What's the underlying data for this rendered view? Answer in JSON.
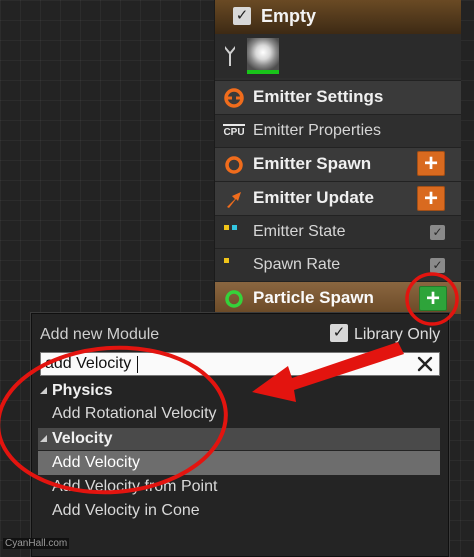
{
  "emitter": {
    "title": "Empty",
    "sections": [
      {
        "label": "Emitter Settings",
        "icon": "emitter-settings-icon"
      },
      {
        "label": "Emitter Properties",
        "icon": "cpu-icon",
        "icon_text": "CPU"
      },
      {
        "label": "Emitter Spawn",
        "icon": "ring-icon"
      },
      {
        "label": "Emitter Update",
        "icon": "arrow-up-right-icon"
      },
      {
        "label": "Emitter State",
        "icon": "state-dots-icon"
      },
      {
        "label": "Spawn Rate",
        "icon": "yellow-dot-icon"
      },
      {
        "label": "Particle Spawn",
        "icon": "green-ring-icon"
      }
    ],
    "plus_symbol": "+",
    "check_symbol": "✓"
  },
  "popup": {
    "title": "Add new Module",
    "library_only_label": "Library Only",
    "search_value": "add Velocity",
    "categories": [
      {
        "label": "Physics",
        "items": [
          "Add Rotational Velocity"
        ]
      },
      {
        "label": "Velocity",
        "items": [
          "Add Velocity",
          "Add Velocity from Point",
          "Add Velocity in Cone"
        ]
      }
    ],
    "selected_item": "Add Velocity"
  },
  "watermark": "CyanHall.com",
  "colors": {
    "accent_orange": "#d96a1f",
    "accent_green": "#2ea43a",
    "annotation_red": "#e3140f"
  }
}
